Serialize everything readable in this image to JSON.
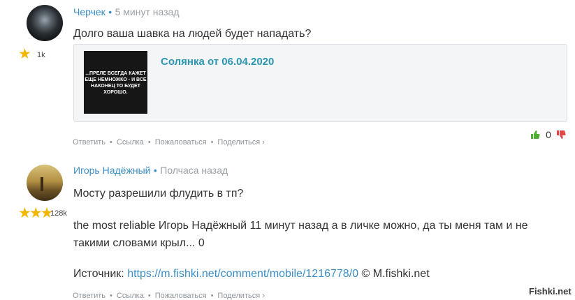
{
  "comments": [
    {
      "author": "Черчек",
      "separator": "•",
      "time": "5 минут назад",
      "text": "Долго ваша шавка на людей будет нападать?",
      "rating_stars": "★",
      "rating_count": "1k",
      "card": {
        "title": "Солянка от 06.04.2020",
        "thumb_lines": [
          "...ПРЕЛЕ ВСЕГДА КАЖЕТ",
          "ЕЩЕ НЕМНОЖКО - И ВСЕ",
          "НАКОНЕЦ ТО БУДЕТ",
          "ХОРОШО."
        ]
      },
      "votes": "0",
      "vote_up_icon": "thumbs-up-icon",
      "vote_down_icon": "thumbs-down-icon"
    },
    {
      "author": "Игорь Надёжный",
      "separator": "•",
      "time": "Полчаса назад",
      "text": "Мосту разрешили флудить в тп?",
      "rating_stars": "★★★",
      "rating_count": "128k",
      "text_line2a": "the most reliable Игорь Надёжный 11 минут назад а в личке можно, да ты меня там и не",
      "text_line2b": "такими словами крыл... 0",
      "source_label": "Источник:",
      "source_url": "https://m.fishki.net/comment/mobile/1216778/0",
      "source_suffix": "© M.fishki.net"
    }
  ],
  "actions": {
    "reply": "Ответить",
    "link": "Ссылка",
    "report": "Пожаловаться",
    "share": "Поделиться ›",
    "separator": "•"
  },
  "watermark": "Fishki.net",
  "colors": {
    "author_link": "#3a8ec6",
    "card_title": "#2a96b4",
    "vote_up": "#4caf32",
    "vote_down": "#e04848",
    "star": "#f1b600"
  }
}
